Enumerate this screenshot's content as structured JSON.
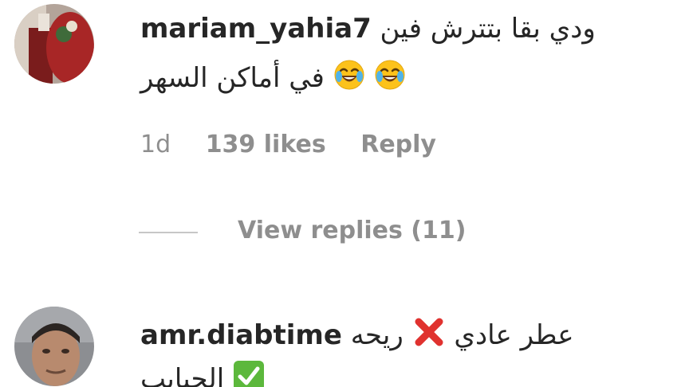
{
  "comments": [
    {
      "username": "mariam_yahia7",
      "text_line1": "ودي بقا بتترش فين",
      "text_line2": "في أماكن السهر",
      "emoji": "face-with-tears-of-joy",
      "time": "1d",
      "likes": "139 likes",
      "reply": "Reply",
      "view_replies": "View replies (11)"
    },
    {
      "username": "amr.diabtime",
      "text_part1": "ريحه",
      "text_part2": "عطر عادي",
      "text_line2": "الحبايب",
      "emoji_cross": "cross-mark",
      "emoji_check": "check-mark-button"
    }
  ],
  "colors": {
    "primary_text": "#262626",
    "secondary_text": "#8e8e8e",
    "divider": "#c7c7c7",
    "cross_red": "#e0322f",
    "check_green": "#5cb83c"
  }
}
